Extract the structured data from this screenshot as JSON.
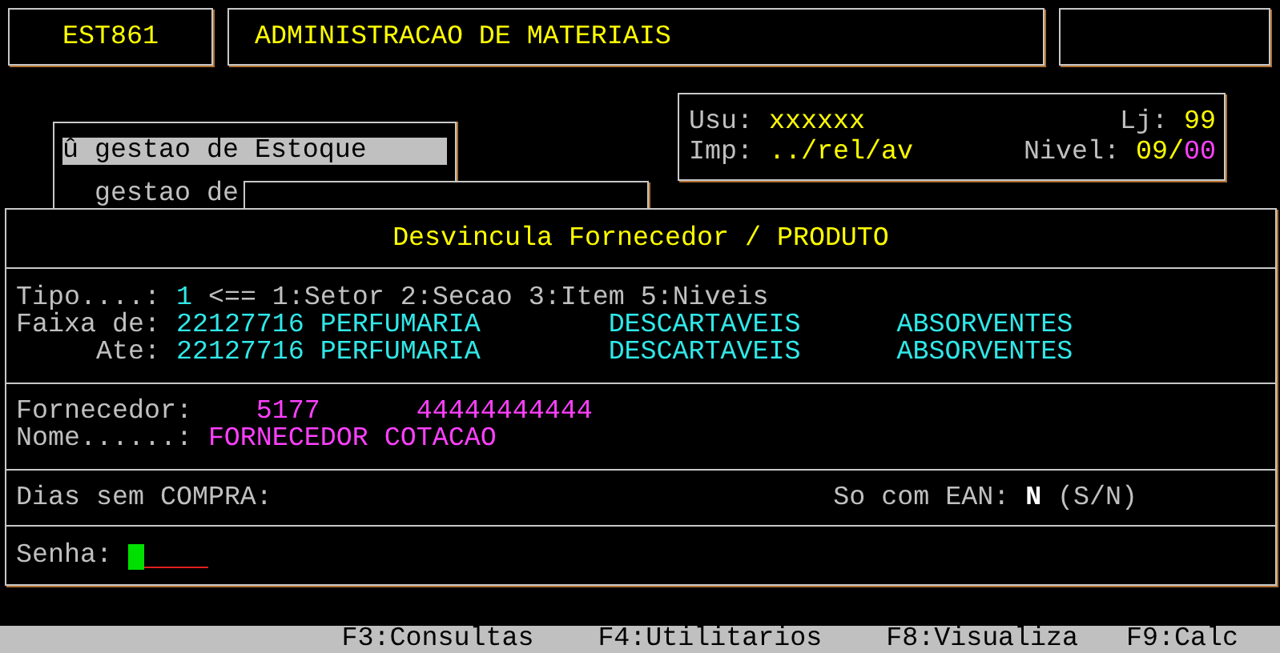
{
  "header": {
    "program": "EST861",
    "title": "ADMINISTRACAO DE MATERIAIS"
  },
  "menu": {
    "items": [
      {
        "marker": "û",
        "label": "gestao de Estoque",
        "selected": true
      },
      {
        "label": "gestao de",
        "selected": false
      }
    ]
  },
  "session": {
    "user_label": "Usu:",
    "user": "xxxxxx",
    "store_label": "Lj:",
    "store": "99",
    "printer_label": "Imp:",
    "printer": "../rel/av",
    "level_label": "Nivel:",
    "level": "09/",
    "sublevel": "00"
  },
  "form": {
    "title": "Desvincula Fornecedor / PRODUTO",
    "tipo": {
      "label": "Tipo....:",
      "value": "1",
      "hint": "<== 1:Setor 2:Secao 3:Item 5:Niveis"
    },
    "ranges": [
      {
        "label": "Faixa de:",
        "code": "22127716",
        "names": [
          "PERFUMARIA",
          "DESCARTAVEIS",
          "ABSORVENTES"
        ]
      },
      {
        "label": "Ate:",
        "code": "22127716",
        "names": [
          "PERFUMARIA",
          "DESCARTAVEIS",
          "ABSORVENTES"
        ]
      }
    ],
    "supplier": {
      "label": "Fornecedor:",
      "code": "5177",
      "document": "44444444444",
      "name_label": "Nome......:",
      "name": "FORNECEDOR COTACAO"
    },
    "days_label": "Dias sem COMPRA:",
    "ean": {
      "label": "So com EAN:",
      "value": "N",
      "options": "(S/N)"
    },
    "password": {
      "label": "Senha:",
      "focused": true
    }
  },
  "function_keys": [
    "F3:Consultas",
    "F4:Utilitarios",
    "F8:Visualiza",
    "F9:Calc"
  ]
}
